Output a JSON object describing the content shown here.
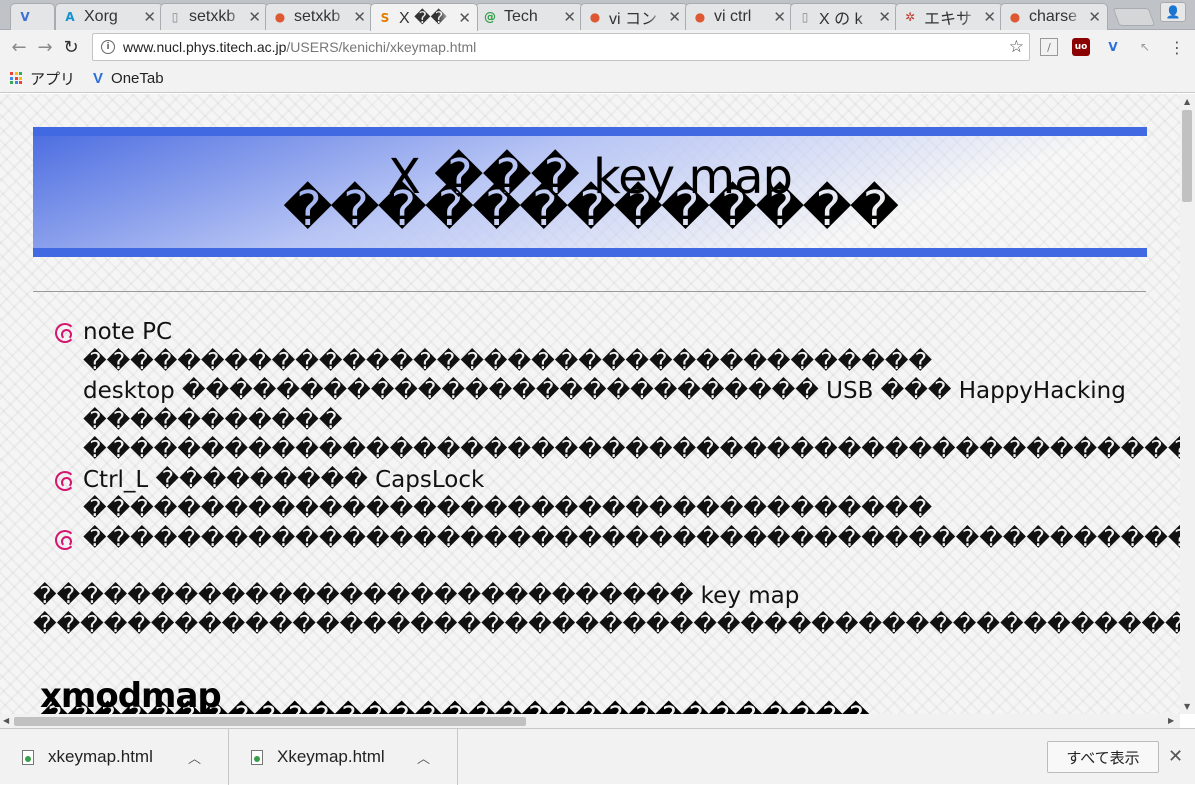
{
  "tabs": [
    {
      "title": "",
      "icon": "onetab-icon",
      "color": "#3b6fd6",
      "glyph": "V"
    },
    {
      "title": "Xorg ",
      "icon": "arch-icon",
      "color": "#1793d1",
      "glyph": "A"
    },
    {
      "title": "setxkb",
      "icon": "page-icon",
      "color": "#888888",
      "glyph": "▯"
    },
    {
      "title": "setxkb",
      "icon": "duckduckgo-icon",
      "color": "#de5833",
      "glyph": "●"
    },
    {
      "title": "X ��",
      "icon": "s-icon",
      "color": "#e07b00",
      "glyph": "S"
    },
    {
      "title": "Tech ",
      "icon": "at-icon",
      "color": "#2e9d45",
      "glyph": "@"
    },
    {
      "title": "vi コン",
      "icon": "duckduckgo-icon",
      "color": "#de5833",
      "glyph": "●"
    },
    {
      "title": "vi ctrl",
      "icon": "duckduckgo-icon",
      "color": "#de5833",
      "glyph": "●"
    },
    {
      "title": "X の k",
      "icon": "page-icon",
      "color": "#888888",
      "glyph": "▯"
    },
    {
      "title": "エキサ",
      "icon": "excite-icon",
      "color": "#c0392b",
      "glyph": "✲"
    },
    {
      "title": "charse",
      "icon": "duckduckgo-icon",
      "color": "#de5833",
      "glyph": "●"
    }
  ],
  "toolbar": {
    "url_host": "www.nucl.phys.titech.ac.jp",
    "url_path": "/USERS/kenichi/xkeymap.html"
  },
  "bookmarks": {
    "apps": "アプリ",
    "onetab": "OneTab"
  },
  "page": {
    "title_line1": "X ��� key map",
    "title_line2": "�������������",
    "list": [
      [
        "note PC",
        "������������������������������������",
        "desktop ��������������������������� USB ��� HappyHacking",
        "�����������",
        "�������������������������������������������������"
      ],
      [
        "Ctrl_L ��������� CapsLock",
        "������������������������������������"
      ],
      [
        "��������������������������������������������������"
      ]
    ],
    "para_line1": "���������������������������� key map",
    "para_line2": "�������������������������������������������������",
    "heading": "xmodmap",
    "heading_sub": "�������������������������������"
  },
  "downloads": [
    {
      "name": "xkeymap.html"
    },
    {
      "name": "Xkeymap.html"
    }
  ],
  "shelf": {
    "show_all": "すべて表示"
  }
}
